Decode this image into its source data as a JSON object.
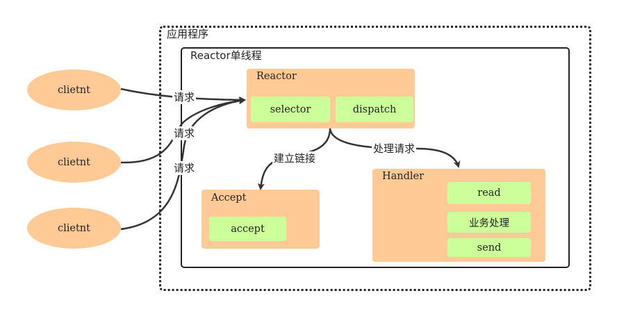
{
  "app": {
    "title": "应用程序"
  },
  "reactor_frame": {
    "title": "Reactor单线程"
  },
  "clients": [
    "clietnt",
    "clietnt",
    "clietnt"
  ],
  "reactor": {
    "title": "Reactor",
    "selector": "selector",
    "dispatch": "dispatch"
  },
  "accept": {
    "title": "Accept",
    "item": "accept"
  },
  "handler": {
    "title": "Handler",
    "items": [
      "read",
      "业务处理",
      "send"
    ]
  },
  "edge_labels": {
    "request": [
      "请求",
      "请求",
      "请求"
    ],
    "build_link": "建立链接",
    "process_request": "处理请求"
  },
  "colors": {
    "box": "#ffca95",
    "inner": "#ccff99",
    "line": "#333333"
  }
}
